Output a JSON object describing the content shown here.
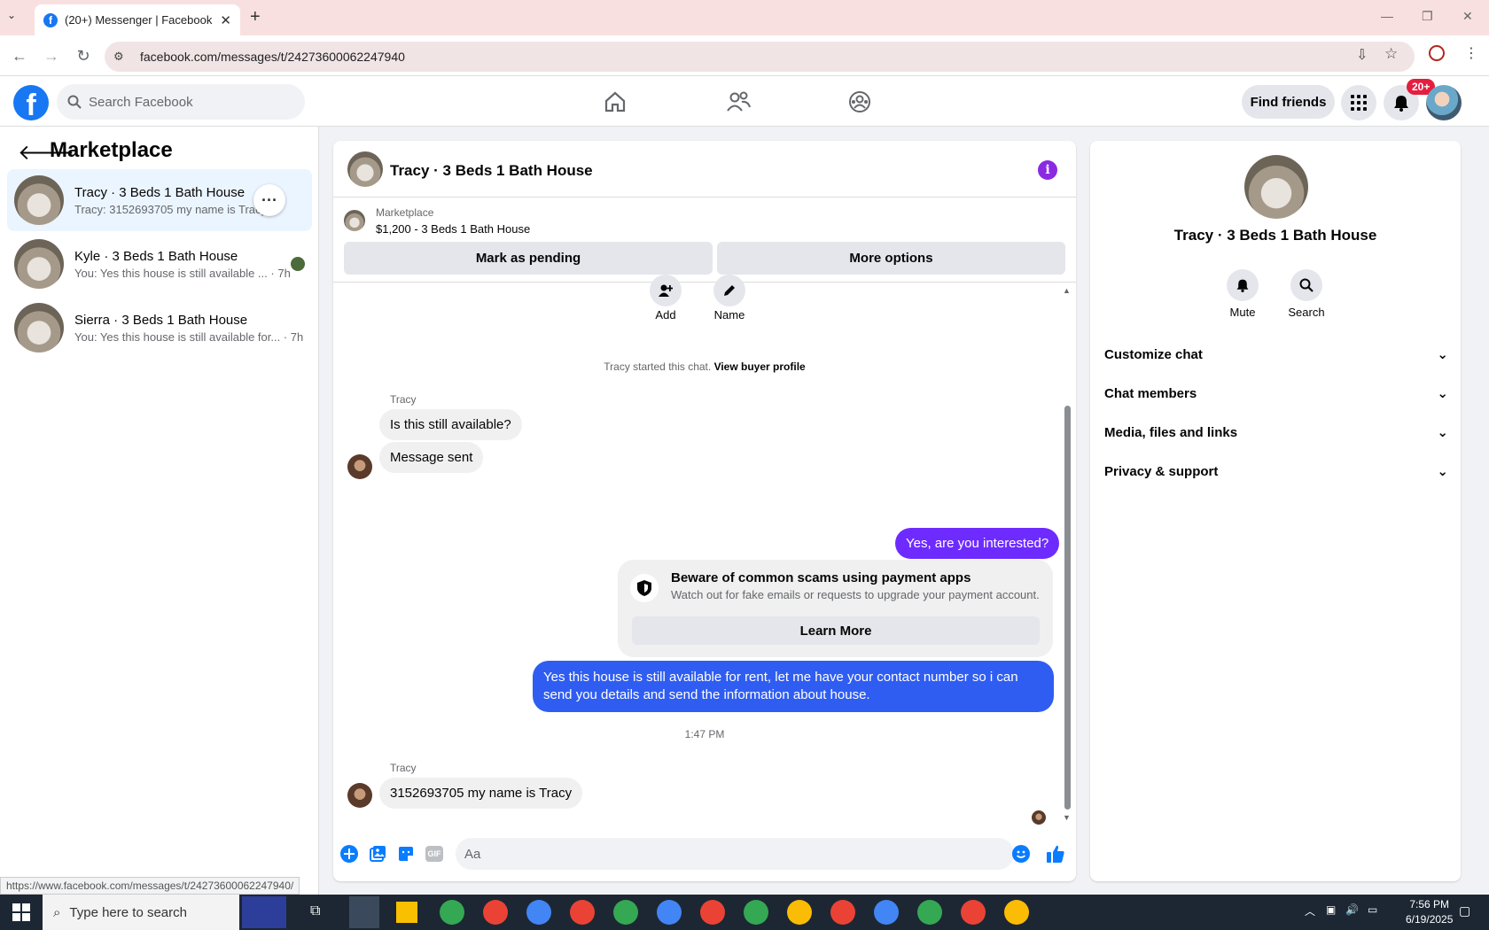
{
  "browser": {
    "tab_title": "(20+) Messenger | Facebook",
    "url": "facebook.com/messages/t/24273600062247940",
    "status_url": "https://www.facebook.com/messages/t/24273600062247940/"
  },
  "header": {
    "search_placeholder": "Search Facebook",
    "find_friends": "Find friends",
    "notif_badge": "20+"
  },
  "sidebar": {
    "title": "Marketplace",
    "conversations": [
      {
        "name": "Tracy · 3 Beds 1 Bath House",
        "preview": "Tracy: 3152693705 my name is Tracy",
        "time": ""
      },
      {
        "name": "Kyle · 3 Beds 1 Bath House",
        "preview": "You: Yes this house is still available ...",
        "time": "· 7h"
      },
      {
        "name": "Sierra · 3 Beds 1 Bath House",
        "preview": "You: Yes this house is still available for...",
        "time": "· 7h"
      }
    ]
  },
  "chat": {
    "title": "Tracy · 3 Beds 1 Bath House",
    "marketplace_label": "Marketplace",
    "listing": "$1,200 - 3 Beds 1 Bath House",
    "mark_pending": "Mark as pending",
    "more_options": "More options",
    "add_label": "Add",
    "name_label": "Name",
    "started_text": "Tracy started this chat.",
    "view_buyer": "View buyer profile",
    "sender1": "Tracy",
    "msg1": "Is this still available?",
    "msg2": "Message sent",
    "msg_out1": "Yes, are you interested?",
    "scam_title": "Beware of common scams using payment apps",
    "scam_body": "Watch out for fake emails or requests to upgrade your payment account.",
    "learn_more": "Learn More",
    "msg_out2_line1": "Yes this house is still available for rent, let me have your contact number so i can",
    "msg_out2_line2": "send you details and send the information about house.",
    "timestamp": "1:47 PM",
    "sender2": "Tracy",
    "msg3": "3152693705 my name is Tracy",
    "composer_placeholder": "Aa"
  },
  "info_panel": {
    "title": "Tracy · 3 Beds 1 Bath House",
    "mute": "Mute",
    "search": "Search",
    "sections": [
      "Customize chat",
      "Chat members",
      "Media, files and links",
      "Privacy & support"
    ]
  },
  "taskbar": {
    "search_placeholder": "Type here to search",
    "time": "7:56 PM",
    "date": "6/19/2025"
  },
  "colors": {
    "accent": "#1877f2",
    "outgoing": "#6e2bff",
    "outgoing_blue": "#2f5df2",
    "selected": "#ebf5ff"
  }
}
